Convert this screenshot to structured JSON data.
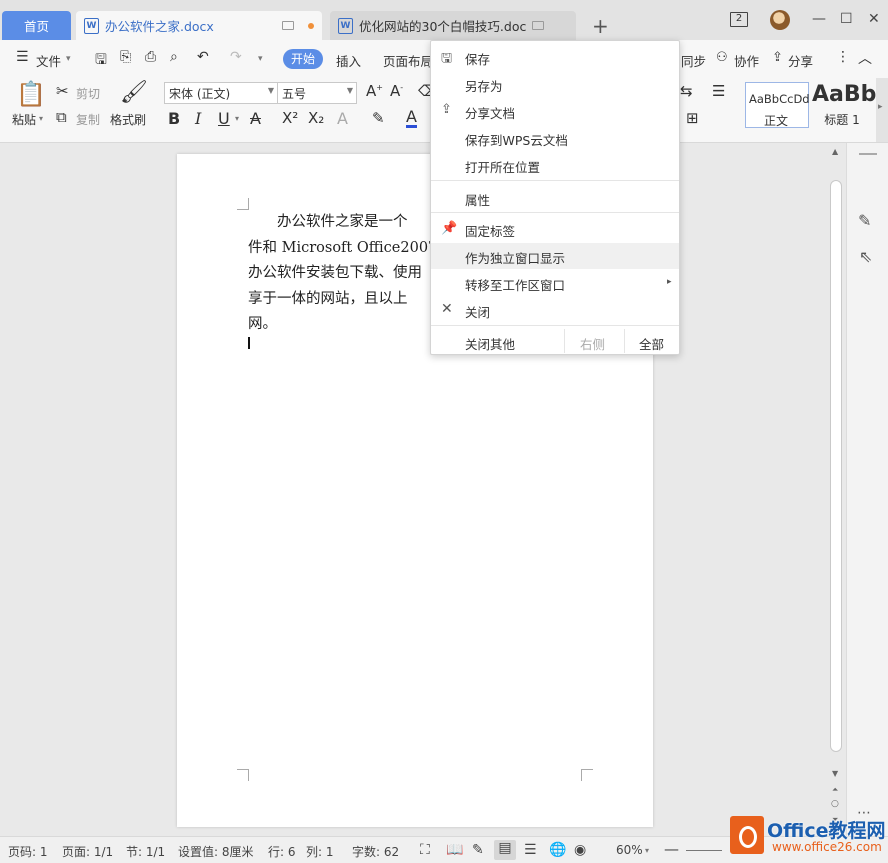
{
  "tabs": {
    "home": "首页",
    "doc1": "办公软件之家.docx",
    "doc2": "优化网站的30个白帽技巧.doc",
    "doc_icon_letter": "W"
  },
  "window": {
    "count": "2"
  },
  "menu": {
    "file": "文件",
    "start": "开始",
    "insert": "插入",
    "page_layout": "页面布局",
    "sync": "同步",
    "collab": "协作",
    "share": "分享"
  },
  "ribbon": {
    "paste": "粘贴",
    "cut": "剪切",
    "copy": "复制",
    "format_painter": "格式刷",
    "font_name": "宋体 (正文)",
    "font_size": "五号",
    "style_normal_preview": "AaBbCcDd",
    "style_normal": "正文",
    "style_h1_preview": "AaBb",
    "style_h1": "标题 1"
  },
  "document": {
    "text": "　　办公软件之家是一个\n件和 Microsoft Office2007\n办公软件安装包下载、使用\n享于一体的网站，且以上\n网。"
  },
  "context_menu": {
    "save": "保存",
    "save_as": "另存为",
    "share_doc": "分享文档",
    "save_to_cloud": "保存到WPS云文档",
    "open_location": "打开所在位置",
    "properties": "属性",
    "pin_tab": "固定标签",
    "show_as_window": "作为独立窗口显示",
    "move_to_workspace": "转移至工作区窗口",
    "close": "关闭",
    "close_others": "关闭其他",
    "right_side": "右侧",
    "all": "全部"
  },
  "status": {
    "page_num": "页码: 1",
    "pages": "页面: 1/1",
    "section": "节: 1/1",
    "setting": "设置值: 8厘米",
    "row": "行: 6",
    "col": "列: 1",
    "word_count": "字数: 62",
    "zoom": "60%"
  },
  "watermark": {
    "title": "Office教程网",
    "url": "www.office26.com"
  }
}
